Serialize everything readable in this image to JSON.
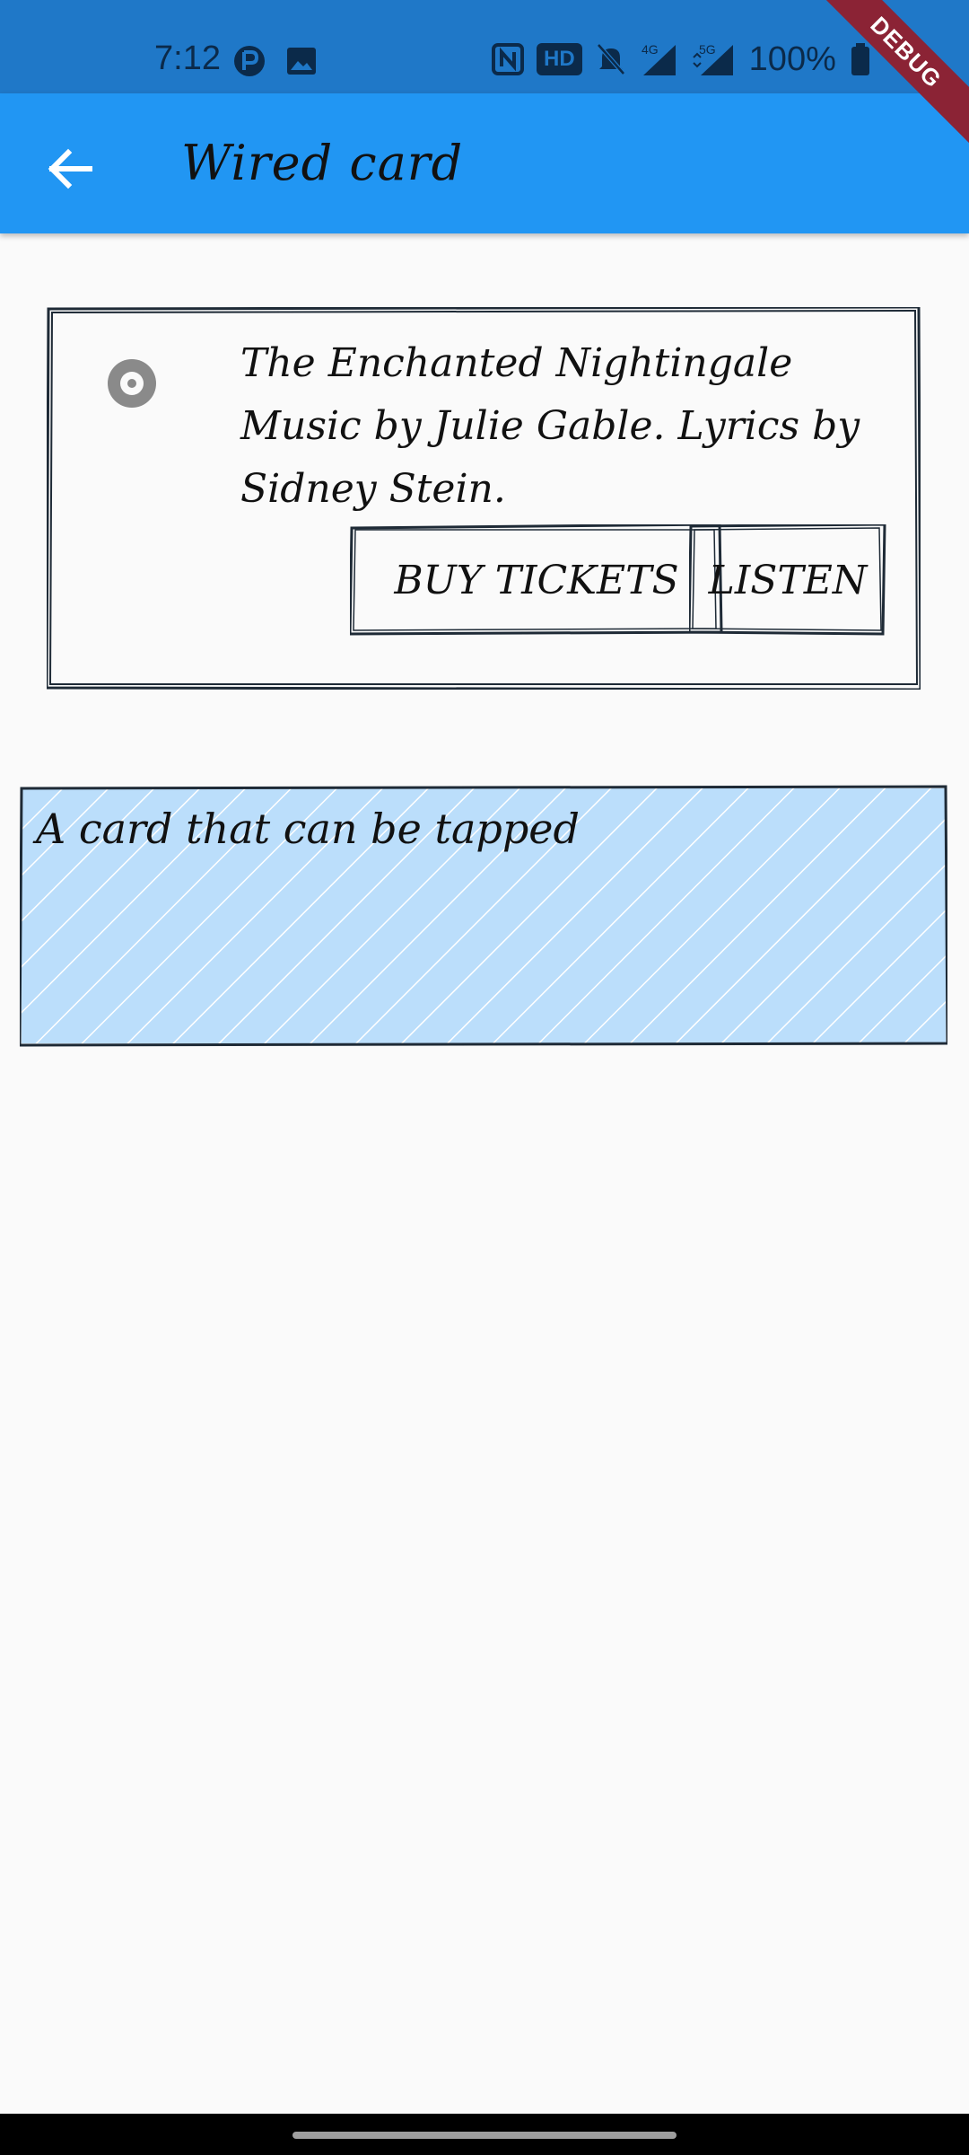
{
  "status_bar": {
    "time": "7:12",
    "network": "4G",
    "network2": "5G",
    "hd_label": "HD",
    "battery": "100%"
  },
  "app_bar": {
    "title": "Wired card",
    "back_icon": "arrow-left-icon",
    "background": "#2196f3"
  },
  "debug_banner": "DEBUG",
  "music_card": {
    "icon": "album-icon",
    "text": "The Enchanted Nightingale Music by Julie Gable. Lyrics by Sidney Stein.",
    "buy_label": "BUY TICKETS",
    "listen_label": "LISTEN"
  },
  "tap_card": {
    "label": "A card that can be tapped",
    "fill": "#bbdefb"
  }
}
